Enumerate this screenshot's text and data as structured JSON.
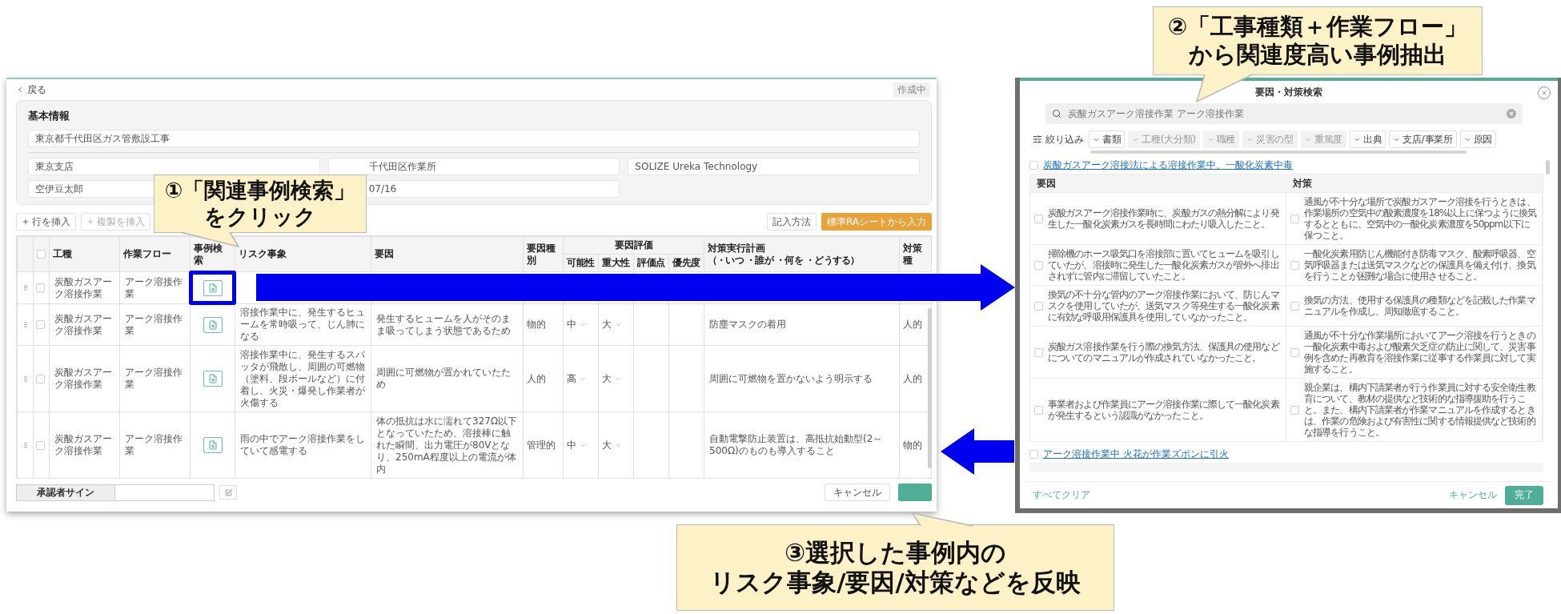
{
  "app_screen": {
    "back_link": "戻る",
    "status_badge": "作成中",
    "info_panel": {
      "title": "基本情報",
      "project_field": "東京都千代田区ガス管敷設工事",
      "fields": [
        {
          "value": "東京支店"
        },
        {
          "value": "千代田区作業所"
        },
        {
          "value": "SOLIZE Ureka Technology"
        },
        {
          "value": "空伊豆太郎"
        },
        {
          "value": "07/16"
        }
      ]
    },
    "toolbar_left": [
      {
        "label": "行を挿入",
        "disabled": false
      },
      {
        "label": "複製を挿入",
        "disabled": true
      }
    ],
    "toolbar_right": [
      {
        "label": "記入方法",
        "kind": "outline"
      },
      {
        "label": "標準RAシートから入力",
        "kind": "primary"
      }
    ],
    "columns": [
      {
        "kind": "handle"
      },
      {
        "kind": "check",
        "checked": false
      },
      {
        "kind": "text",
        "label": "工種"
      },
      {
        "kind": "text",
        "label": "作業フロー"
      },
      {
        "kind": "text",
        "label": "事例検索"
      },
      {
        "kind": "text",
        "label": "リスク事象"
      },
      {
        "kind": "text",
        "label": "要因"
      },
      {
        "kind": "text",
        "label": "要因種別"
      },
      {
        "kind": "group",
        "label": "要因評価",
        "children": [
          {
            "label": "可能性"
          },
          {
            "label": "重大性"
          },
          {
            "label": "評価点"
          },
          {
            "label": "優先度"
          }
        ]
      },
      {
        "kind": "text",
        "label": "対策実行計画",
        "sublabel": "（・いつ ・誰が ・何を ・どうする）"
      },
      {
        "kind": "text",
        "label": "対策種"
      }
    ],
    "rows": [
      {
        "checked": false,
        "highlighted": true,
        "work_type": "炭酸ガスアーク溶接作業",
        "flow": "アーク溶接作業"
      },
      {
        "checked": false,
        "highlighted": false,
        "work_type": "炭酸ガスアーク溶接作業",
        "flow": "アーク溶接作業",
        "risk": "溶接作業中に、発生するヒュームを常時吸って、じん肺になる",
        "cause": "発生するヒュームを人がそのまま吸ってしまう状態であるため",
        "cause_type": "物的",
        "likelihood": "中",
        "severity": "大",
        "plan": "防塵マスクの着用",
        "measure_type": "人的"
      },
      {
        "checked": false,
        "highlighted": false,
        "work_type": "炭酸ガスアーク溶接作業",
        "flow": "アーク溶接作業",
        "risk": "溶接作業中に、発生するスパッタが飛散し、周囲の可燃物（塗料、段ボールなど）に付着し、火災・爆発し作業者が火傷する",
        "cause": "周囲に可燃物が置かれていたため",
        "cause_type": "人的",
        "likelihood": "高",
        "severity": "大",
        "plan": "周囲に可燃物を置かないよう明示する",
        "measure_type": "人的"
      },
      {
        "checked": false,
        "highlighted": false,
        "work_type": "炭酸ガスアーク溶接作業",
        "flow": "アーク溶接作業",
        "risk": "雨の中でアーク溶接作業をしていて感電する",
        "cause": "体の抵抗は水に濡れて327Ω以下となっていたため、溶接棒に触れた瞬間、出力電圧が80Vとなり、250mA程度以上の電流が体内",
        "cause_type": "管理的",
        "likelihood": "中",
        "severity": "大",
        "plan": "自動電撃防止装置は、高抵抗始動型(2～500Ω)のものも導入すること",
        "measure_type": "物的"
      }
    ],
    "footer": {
      "sign_label": "承認者サイン",
      "cancel": "キャンセル"
    }
  },
  "search_modal": {
    "title": "要因・対策検索",
    "search_value": "炭酸ガスアーク溶接作業 アーク溶接作業",
    "filter_label": "絞り込み",
    "filters": [
      {
        "label": "書類",
        "disabled": false
      },
      {
        "label": "工種(大分類)",
        "disabled": true
      },
      {
        "label": "職種",
        "disabled": true
      },
      {
        "label": "災害の型",
        "disabled": true
      },
      {
        "label": "重篤度",
        "disabled": true
      },
      {
        "label": "出典",
        "disabled": false
      },
      {
        "label": "支店/事業所",
        "disabled": false
      },
      {
        "label": "原因",
        "disabled": false
      }
    ],
    "cases": [
      {
        "title": "炭酸ガスアーク溶接法による溶接作業中、一酸化炭素中毒",
        "checked": false,
        "columns": [
          "要因",
          "対策"
        ],
        "rows": [
          {
            "cause": "炭酸ガスアーク溶接作業時に、炭酸ガスの熱分解により発生した一酸化炭素ガスを長時間にわたり吸入したこと。",
            "cause_checked": false,
            "measure": "通風が不十分な場所で炭酸ガスアーク溶接を行うときは、作業場所の空気中の酸素濃度を18%以上に保つように換気するとともに、空気中の一酸化炭素濃度を50ppm以下に保つこと。",
            "measure_checked": false
          },
          {
            "cause": "掃除機のホース吸気口を溶接部に置いてヒュームを吸引していたが、溶接時に発生した一酸化炭素ガスが管外へ排出されずに管内に滞留していたこと。",
            "cause_checked": false,
            "measure": "一酸化炭素用防じん機能付き防毒マスク、酸素呼吸器、空気呼吸器または送気マスクなどの保護具を備え付け、換気を行うことが困難な場合に使用させること。",
            "measure_checked": false
          },
          {
            "cause": "換気の不十分な管内のアーク溶接作業において、防じんマスクを使用していたが、送気マスク等発生する一酸化炭素に有効な呼吸用保護具を使用していなかったこと。",
            "cause_checked": false,
            "measure": "換気の方法、使用する保護具の種類などを記載した作業マニュアルを作成し、周知徹底すること。",
            "measure_checked": false
          },
          {
            "cause": "炭酸ガス溶接作業を行う際の換気方法、保護具の使用などについてのマニュアルが作成されていなかったこと。",
            "cause_checked": false,
            "measure": "通風が不十分な作業場所においてアーク溶接を行うときの一酸化炭素中毒および酸素欠乏症の防止に関して、災害事例を含めた再教育を溶接作業に従事する作業員に対して実施すること。",
            "measure_checked": false
          },
          {
            "cause": "事業者および作業員にアーク溶接作業に際して一酸化炭素が発生するという認識がなかったこと。",
            "cause_checked": false,
            "measure": "親企業は、構内下請業者が行う作業員に対する安全衛生教育について、教材の提供など技術的な指導援助を行うこと。また、構内下請業者が作業マニュアルを作成するときは、作業の危険および有害性に関する情報提供など技術的な指導を行うこと。",
            "measure_checked": false
          }
        ]
      },
      {
        "title": "アーク溶接作業中 火花が作業ズボンに引火",
        "checked": false
      }
    ],
    "footer": {
      "clear": "すべてクリア",
      "cancel": "キャンセル",
      "done": "完了"
    }
  },
  "callouts": [
    {
      "lines": [
        "①「関連事例検索」",
        "をクリック"
      ]
    },
    {
      "lines": [
        "②「工事種類＋作業フロー」",
        "から関連度高い事例抽出"
      ]
    },
    {
      "lines": [
        "③選択した事例内の",
        "リスク事象/要因/対策などを反映"
      ]
    }
  ]
}
